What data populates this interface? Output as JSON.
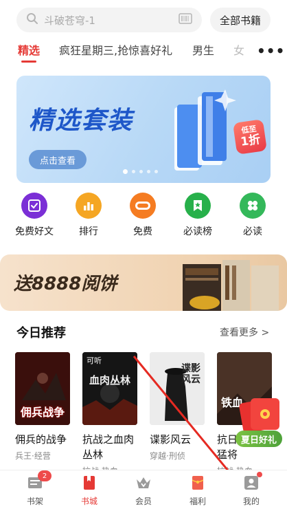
{
  "search": {
    "placeholder": "斗破苍穹-1"
  },
  "header": {
    "all_books_label": "全部书籍"
  },
  "tabs": [
    {
      "label": "精选"
    },
    {
      "label": "疯狂星期三,抢惊喜好礼"
    },
    {
      "label": "男生"
    },
    {
      "label": "女"
    }
  ],
  "banner": {
    "title": "精选套装",
    "button_label": "点击查看",
    "badge_small": "低至",
    "badge_big": "1折"
  },
  "quick_entries": [
    {
      "label": "免费好文",
      "icon": "checkbox-icon",
      "color": "#7b2fd6"
    },
    {
      "label": "排行",
      "icon": "bar-chart-icon",
      "color": "#f5a623"
    },
    {
      "label": "免费",
      "icon": "free-tag-icon",
      "color": "#f57c22"
    },
    {
      "label": "必读榜",
      "icon": "star-ribbon-icon",
      "color": "#27b04a"
    },
    {
      "label": "必读",
      "icon": "clover-icon",
      "color": "#34b85a"
    }
  ],
  "promo": {
    "text": "送8888阅饼"
  },
  "today": {
    "title": "今日推荐",
    "more_label": "查看更多 >",
    "books": [
      {
        "title": "佣兵的战争",
        "meta": "兵王·经营",
        "cover_text": "佣兵战争"
      },
      {
        "title": "抗战之血肉丛林",
        "meta": "抗战·热血",
        "cover_text": "血肉丛林",
        "cover_tag": "可听"
      },
      {
        "title": "谍影风云",
        "meta": "穿越·刑侦",
        "cover_text": "谍影风云"
      },
      {
        "title": "抗日之铁血猛将",
        "meta": "抗战·热血",
        "cover_text": "铁血"
      }
    ]
  },
  "floating": {
    "label": "夏日好礼"
  },
  "bottom_nav": [
    {
      "label": "书架",
      "icon": "bookshelf-icon",
      "badge": "2"
    },
    {
      "label": "书城",
      "icon": "bookstore-icon",
      "active": true
    },
    {
      "label": "会员",
      "icon": "crown-icon"
    },
    {
      "label": "福利",
      "icon": "red-envelope-icon"
    },
    {
      "label": "我的",
      "icon": "profile-icon"
    }
  ],
  "colors": {
    "accent": "#e53935",
    "banner_blue": "#1e57c9"
  }
}
